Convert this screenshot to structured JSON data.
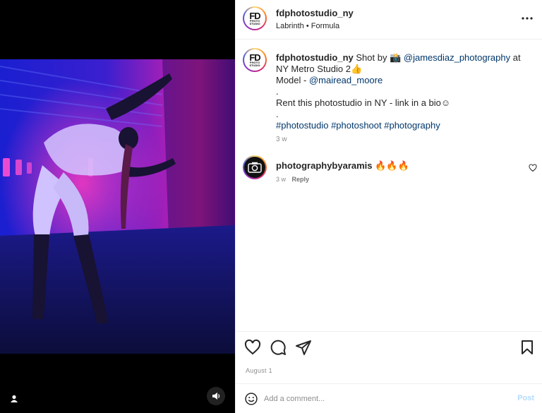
{
  "post": {
    "username": "fdphotostudio_ny",
    "audio": {
      "artist": "Labrinth",
      "separator": "•",
      "track": "Formula"
    },
    "avatar_logo": {
      "main": "FD",
      "line1": "PHOTO",
      "line2": "STUDIO"
    }
  },
  "caption": {
    "username": "fdphotostudio_ny",
    "text_shot_by": " Shot by 📸 ",
    "photographer": "@jamesdiaz_photography",
    "text_location": " at NY Metro Studio 2👍",
    "model_label": "Model - ",
    "model": "@mairead_moore",
    "dot1": ".",
    "rent_text": "Rent this photostudio in NY - link in a bio☺",
    "dot2": ".",
    "hashtags": "#photostudio #photoshoot #photography",
    "time": "3 w"
  },
  "comments": [
    {
      "username": "photographybyaramis",
      "text": " 🔥🔥🔥",
      "time": "3 w",
      "reply_label": "Reply"
    }
  ],
  "actions": {
    "like_icon": "heart-icon",
    "comment_icon": "comment-bubble-icon",
    "share_icon": "paper-plane-icon",
    "save_icon": "bookmark-icon"
  },
  "date": "August 1",
  "add_comment": {
    "placeholder": "Add a comment...",
    "post_label": "Post"
  },
  "colors": {
    "link": "#00376b",
    "muted": "#8e8e8e",
    "post_disabled": "#b3dbff",
    "neon_pink": "#ff1fa8",
    "neon_blue": "#2a3cff"
  }
}
